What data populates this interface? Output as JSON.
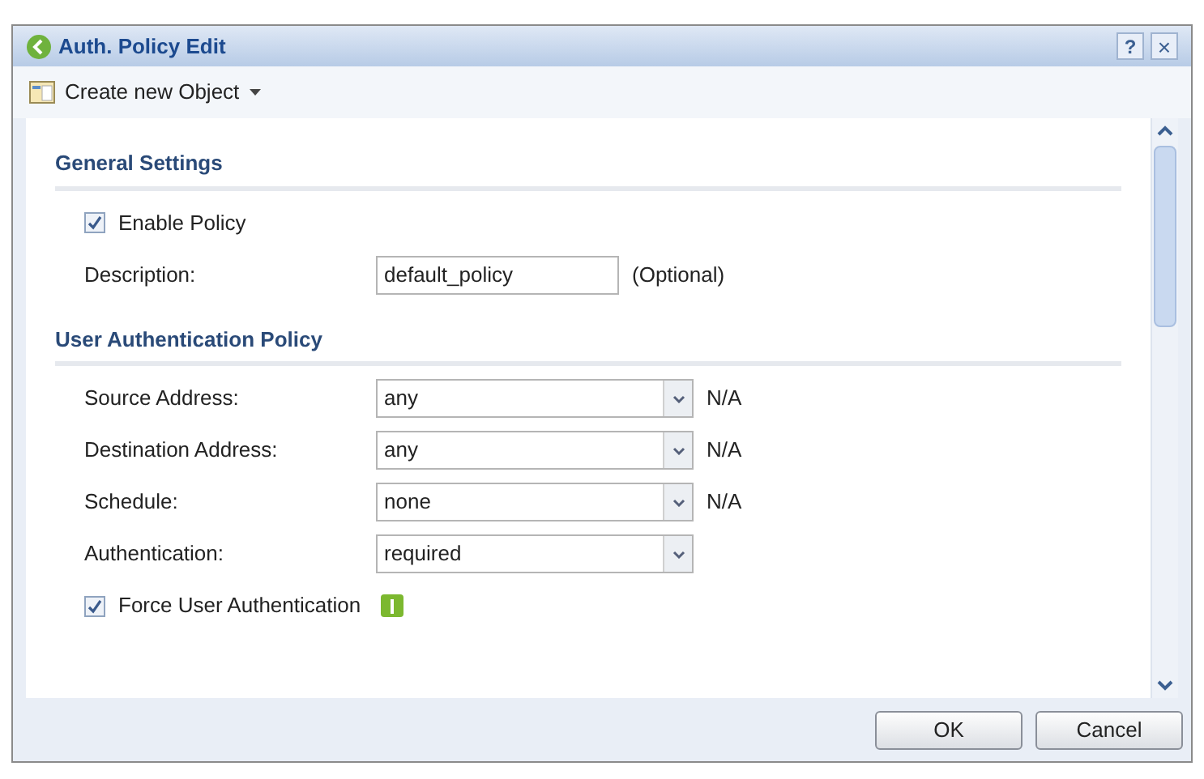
{
  "window": {
    "title": "Auth. Policy Edit",
    "help": "?",
    "close": "×"
  },
  "toolbar": {
    "create_menu": "Create new Object"
  },
  "sections": [
    {
      "title": "General Settings",
      "fields": [
        {
          "kind": "checkbox",
          "label": "Enable Policy",
          "checked": true
        },
        {
          "kind": "text",
          "label": "Description:",
          "value": "default_policy",
          "note": "(Optional)"
        }
      ]
    },
    {
      "title": "User Authentication Policy",
      "fields": [
        {
          "kind": "select",
          "label": "Source Address:",
          "value": "any",
          "note": "N/A"
        },
        {
          "kind": "select",
          "label": "Destination Address:",
          "value": "any",
          "note": "N/A"
        },
        {
          "kind": "select",
          "label": "Schedule:",
          "value": "none",
          "note": "N/A"
        },
        {
          "kind": "select",
          "label": "Authentication:",
          "value": "required"
        },
        {
          "kind": "checkbox",
          "label": "Force User Authentication",
          "checked": true,
          "info": true
        }
      ]
    }
  ],
  "buttons": [
    "OK",
    "Cancel"
  ]
}
